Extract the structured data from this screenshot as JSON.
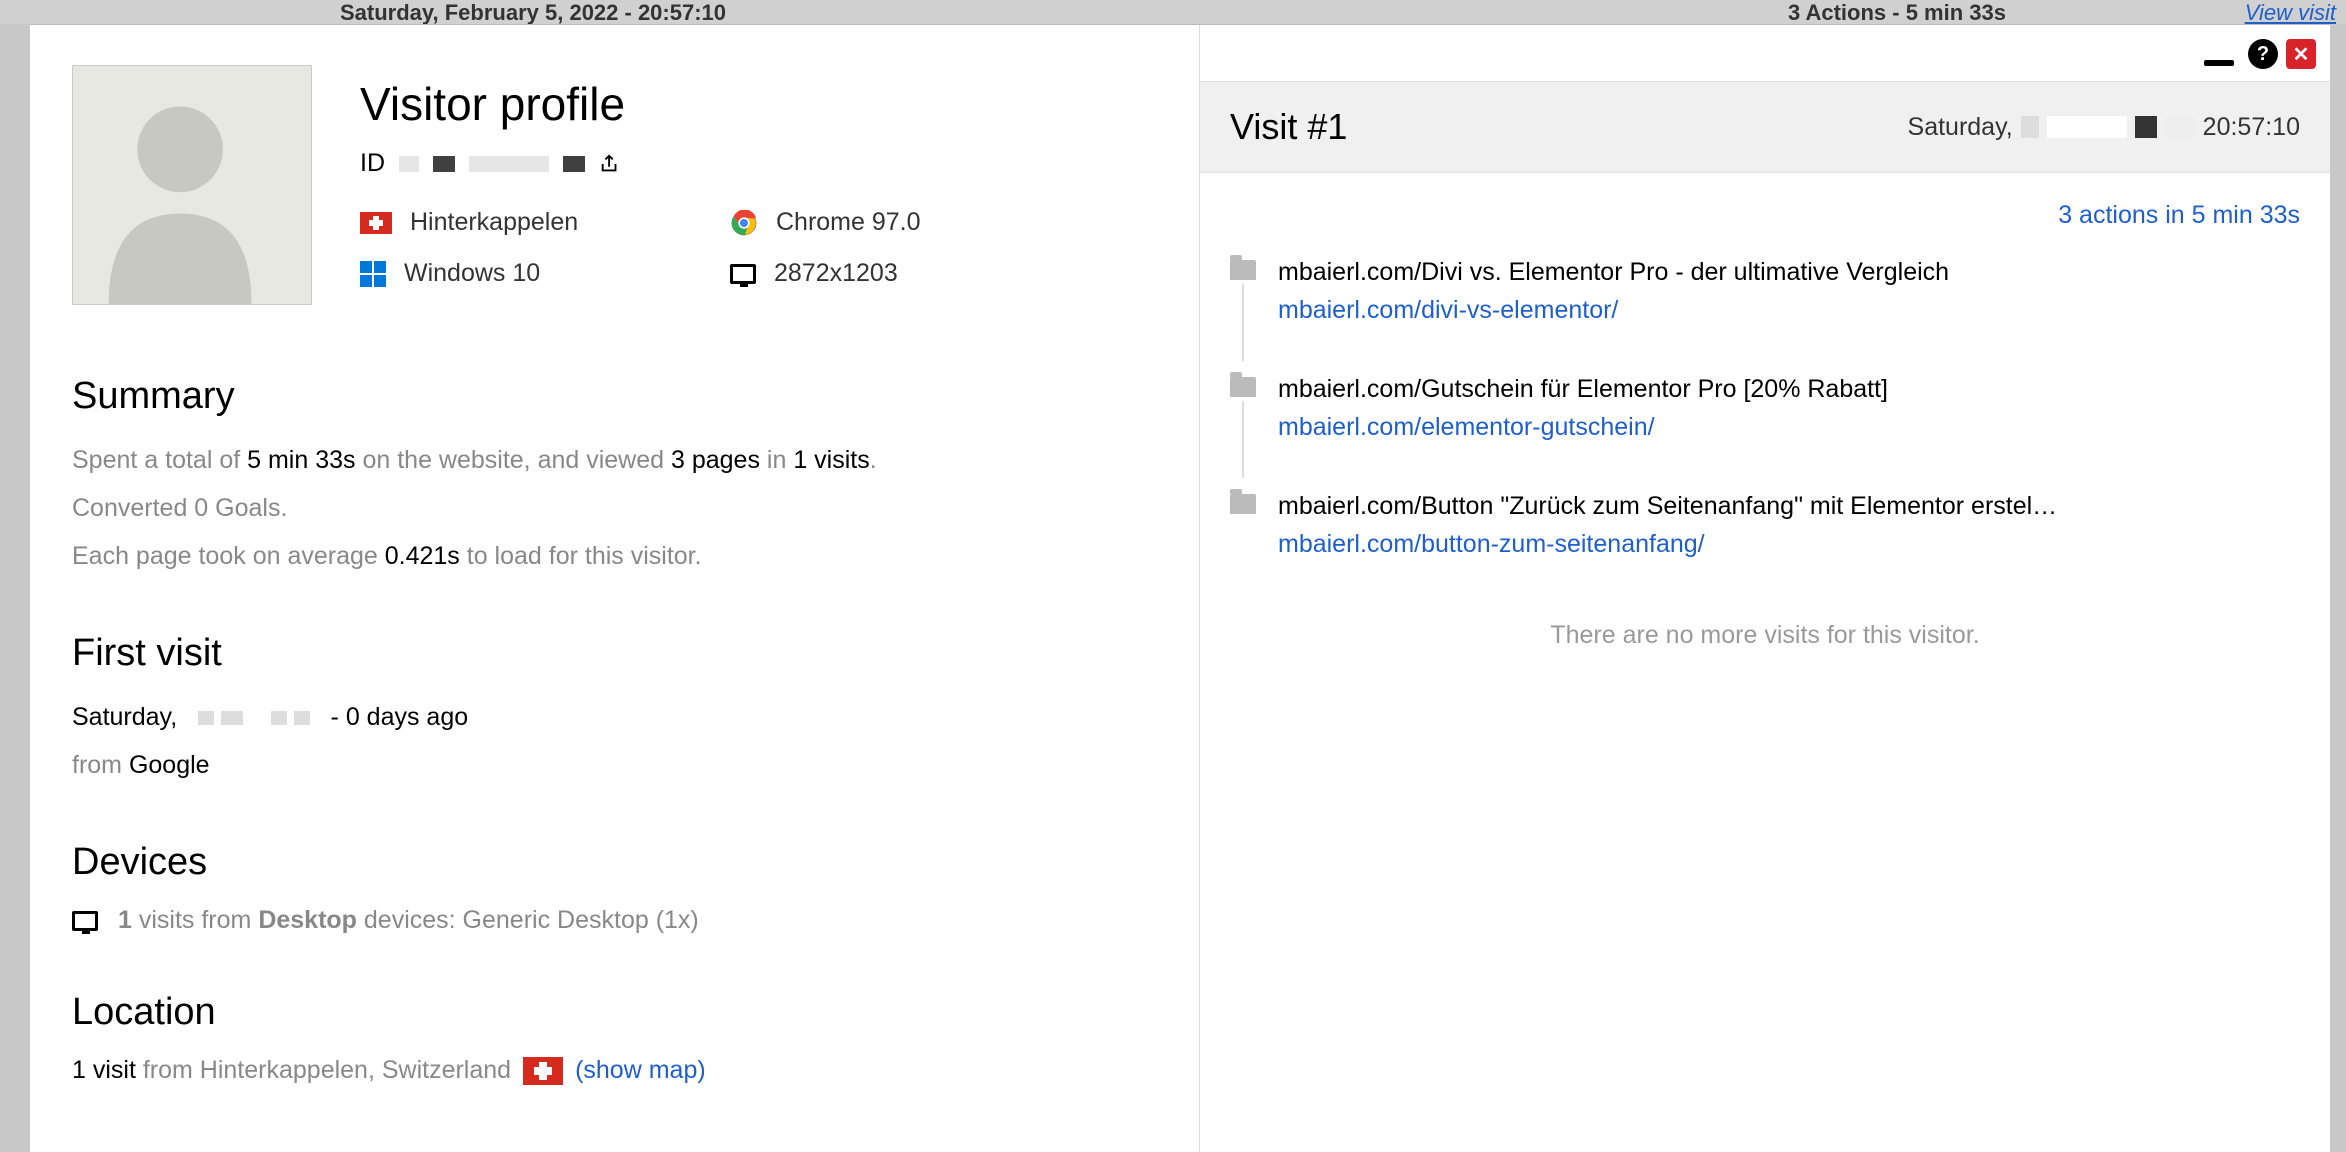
{
  "background": {
    "datetime": "Saturday, February 5, 2022 - 20:57:10",
    "actions": "3 Actions - 5 min 33s",
    "view_visit": "View visit"
  },
  "profile": {
    "title": "Visitor profile",
    "id_label": "ID",
    "location_city": "Hinterkappelen",
    "browser": "Chrome 97.0",
    "os": "Windows 10",
    "resolution": "2872x1203"
  },
  "summary": {
    "heading": "Summary",
    "spent_prefix": "Spent a total of ",
    "spent_time": "5 min 33s",
    "spent_mid": " on the website, and viewed ",
    "pages": "3 pages",
    "in": " in ",
    "visits": "1 visits",
    "converted": "Converted 0 Goals.",
    "avg_prefix": "Each page took on average ",
    "avg_time": "0.421s",
    "avg_suffix": " to load for this visitor."
  },
  "first_visit": {
    "heading": "First visit",
    "day": "Saturday,",
    "ago": "- 0 days ago",
    "from_label": "from ",
    "from_source": "Google"
  },
  "devices": {
    "heading": "Devices",
    "count": "1",
    "mid": " visits from ",
    "type": "Desktop",
    "suffix": " devices: Generic Desktop (1x)"
  },
  "location": {
    "heading": "Location",
    "count": "1 visit",
    "from": " from Hinterkappelen, Switzerland ",
    "show_map": "(show map)"
  },
  "visit": {
    "title": "Visit #1",
    "day_prefix": "Saturday, ",
    "time": "20:57:10",
    "actions_summary": "3 actions in 5 min 33s",
    "no_more": "There are no more visits for this visitor.",
    "actions": [
      {
        "title": "mbaierl.com/Divi vs. Elementor Pro - der ultimative Vergleich",
        "url": "mbaierl.com/divi-vs-elementor/"
      },
      {
        "title": "mbaierl.com/Gutschein für Elementor Pro [20% Rabatt]",
        "url": "mbaierl.com/elementor-gutschein/"
      },
      {
        "title": "mbaierl.com/Button \"Zurück zum Seitenanfang\" mit Elementor erstel…",
        "url": "mbaierl.com/button-zum-seitenanfang/"
      }
    ]
  }
}
